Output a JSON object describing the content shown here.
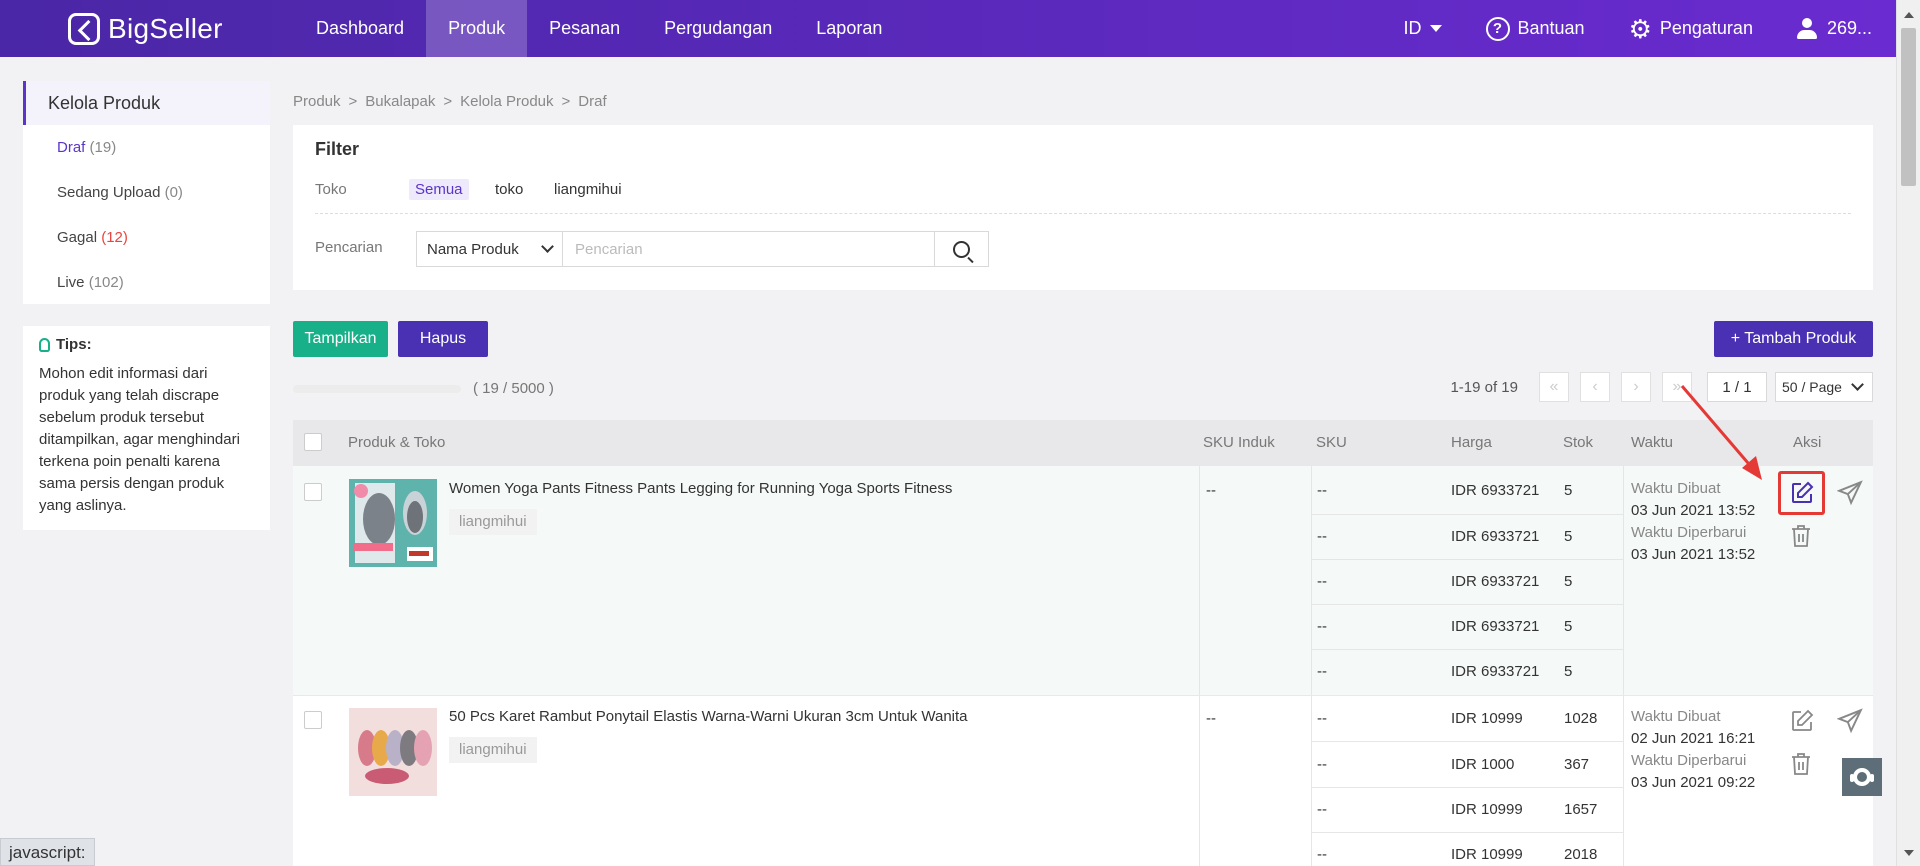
{
  "brand": {
    "name": "BigSeller"
  },
  "nav": {
    "items": [
      "Dashboard",
      "Produk",
      "Pesanan",
      "Pergudangan",
      "Laporan"
    ],
    "active": "Produk",
    "lang": "ID",
    "help": "Bantuan",
    "settings": "Pengaturan",
    "user": "269..."
  },
  "sidebar": {
    "title": "Kelola Produk",
    "items": [
      {
        "label": "Draf",
        "count": "(19)"
      },
      {
        "label": "Sedang Upload",
        "count": "(0)"
      },
      {
        "label": "Gagal",
        "count": "(12)"
      },
      {
        "label": "Live",
        "count": "(102)"
      }
    ]
  },
  "tips": {
    "title": "Tips:",
    "body": "Mohon edit informasi dari produk yang telah discrape sebelum produk tersebut ditampilkan, agar menghindari terkena poin penalti karena sama persis dengan produk yang aslinya."
  },
  "breadcrumb": [
    "Produk",
    "Bukalapak",
    "Kelola Produk",
    "Draf"
  ],
  "filter": {
    "title": "Filter",
    "toko_label": "Toko",
    "toko_options": [
      "Semua",
      "toko",
      "liangmihui"
    ],
    "search_label": "Pencarian",
    "search_field": "Nama Produk",
    "search_placeholder": "Pencarian"
  },
  "actions": {
    "show": "Tampilkan",
    "delete": "Hapus",
    "add": "+ Tambah Produk"
  },
  "quota": {
    "text": "( 19 / 5000 )",
    "fraction": 0.0038
  },
  "pager": {
    "info": "1-19 of 19",
    "page": "1 / 1",
    "page_size": "50 / Page"
  },
  "table": {
    "headers": [
      "Produk & Toko",
      "SKU Induk",
      "SKU",
      "Harga",
      "Stok",
      "Waktu",
      "Aksi"
    ],
    "rows": [
      {
        "name": "Women Yoga Pants Fitness Pants Legging for Running Yoga Sports Fitness",
        "store": "liangmihui",
        "sku_induk": "--",
        "variants": [
          {
            "sku": "--",
            "price": "IDR 6933721",
            "stock": "5"
          },
          {
            "sku": "--",
            "price": "IDR 6933721",
            "stock": "5"
          },
          {
            "sku": "--",
            "price": "IDR 6933721",
            "stock": "5"
          },
          {
            "sku": "--",
            "price": "IDR 6933721",
            "stock": "5"
          },
          {
            "sku": "--",
            "price": "IDR 6933721",
            "stock": "5"
          }
        ],
        "created_label": "Waktu Dibuat",
        "created": "03 Jun 2021 13:52",
        "updated_label": "Waktu Diperbarui",
        "updated": "03 Jun 2021 13:52"
      },
      {
        "name": "50 Pcs Karet Rambut Ponytail Elastis Warna-Warni Ukuran 3cm Untuk Wanita",
        "store": "liangmihui",
        "sku_induk": "--",
        "variants": [
          {
            "sku": "--",
            "price": "IDR 10999",
            "stock": "1028"
          },
          {
            "sku": "--",
            "price": "IDR 1000",
            "stock": "367"
          },
          {
            "sku": "--",
            "price": "IDR 10999",
            "stock": "1657"
          },
          {
            "sku": "--",
            "price": "IDR 10999",
            "stock": "2018"
          }
        ],
        "created_label": "Waktu Dibuat",
        "created": "02 Jun 2021 16:21",
        "updated_label": "Waktu Diperbarui",
        "updated": "03 Jun 2021 09:22"
      }
    ]
  },
  "status_bar": "javascript:",
  "colors": {
    "nav_start": "#4a27a6",
    "nav_end": "#6a2bd0",
    "accent": "#5b34c9",
    "green": "#18b089",
    "danger": "#e53935"
  }
}
